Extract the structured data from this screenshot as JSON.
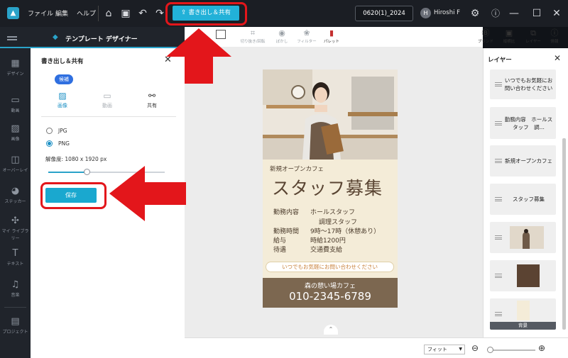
{
  "menu": {
    "file": "ファイル",
    "edit": "編集",
    "help": "ヘルプ"
  },
  "toolbar": {
    "export_label": "書き出し＆共有"
  },
  "project": {
    "name": "0620(1)_2024"
  },
  "user": {
    "initial": "H",
    "name": "Hiroshi F"
  },
  "designer": {
    "title": "テンプレート デザイナー"
  },
  "sidebar": {
    "items": [
      {
        "label": "デザイン",
        "icon": "design-icon"
      },
      {
        "label": "動画",
        "icon": "video-icon"
      },
      {
        "label": "画像",
        "icon": "image-icon"
      },
      {
        "label": "オーバーレイ",
        "icon": "overlay-icon"
      },
      {
        "label": "ステッカー",
        "icon": "sticker-icon"
      },
      {
        "label": "マイ ライブラリー",
        "icon": "library-icon"
      },
      {
        "label": "テキスト",
        "icon": "text-icon"
      },
      {
        "label": "音楽",
        "icon": "music-icon"
      },
      {
        "label": "プロジェクト",
        "icon": "project-icon"
      }
    ]
  },
  "export_panel": {
    "title": "書き出し＆共有",
    "badge": "候補",
    "tabs": [
      {
        "label": "画像"
      },
      {
        "label": "動画"
      },
      {
        "label": "共有"
      }
    ],
    "formats": [
      {
        "label": "JPG",
        "selected": false
      },
      {
        "label": "PNG",
        "selected": true
      }
    ],
    "resolution": "解像度: 1080 x 1920 px",
    "resolution_slider": 0.33,
    "save_label": "保存"
  },
  "canvas_tools": [
    {
      "label": "切り抜き/回転"
    },
    {
      "label": "ぼかし"
    },
    {
      "label": "フィルター"
    },
    {
      "label": "パレット"
    }
  ],
  "right_tools": [
    {
      "label": "ブランド"
    },
    {
      "label": "縦横比"
    },
    {
      "label": "レイヤー"
    },
    {
      "label": "情報"
    }
  ],
  "flyer": {
    "subtitle": "新規オープンカフェ",
    "title": "スタッフ募集",
    "rows": [
      {
        "key": "勤務内容",
        "value": "ホールスタッフ"
      },
      {
        "key": "",
        "value": "調理スタッフ"
      },
      {
        "key": "勤務時間",
        "value": "9時～17時（休憩あり）"
      },
      {
        "key": "給与",
        "value": "時給1200円"
      },
      {
        "key": "待遇",
        "value": "交通費支給"
      }
    ],
    "note": "いつでもお気軽にお問い合わせください",
    "shop": "森の憩い場カフェ",
    "phone": "010-2345-6789"
  },
  "layers": {
    "title": "レイヤー",
    "items": [
      {
        "text": "いつでもお気軽にお問い合わせください",
        "type": "text"
      },
      {
        "text": "勤務内容　ホールスタッフ　調...",
        "type": "text"
      },
      {
        "text": "新規オープンカフェ",
        "type": "text"
      },
      {
        "text": "スタッフ募集",
        "type": "text"
      },
      {
        "text": "",
        "type": "photo"
      },
      {
        "text": "",
        "type": "color"
      },
      {
        "text": "背景",
        "type": "background"
      }
    ]
  },
  "zoom": {
    "mode": "フィット"
  },
  "colors": {
    "accent": "#22b1d8",
    "annotation": "#e3161b",
    "flyer_brown": "#7c6750",
    "flyer_cream": "#f4ecd8"
  }
}
